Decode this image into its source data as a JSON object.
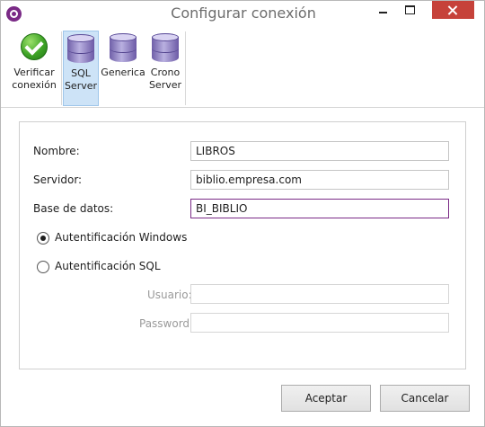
{
  "window": {
    "title": "Configurar conexión",
    "app_icon": "app-logo-icon"
  },
  "toolbar": {
    "items": [
      {
        "label": "Verificar conexión",
        "icon": "check-icon"
      },
      {
        "label": "SQL Server",
        "icon": "database-icon",
        "selected": true
      },
      {
        "label": "Generica",
        "icon": "database-icon"
      },
      {
        "label": "Crono Server",
        "icon": "database-icon"
      }
    ]
  },
  "form": {
    "nombre_label": "Nombre:",
    "nombre_value": "LIBROS",
    "servidor_label": "Servidor:",
    "servidor_value": "biblio.empresa.com",
    "base_label": "Base de datos:",
    "base_value": "BI_BIBLIO",
    "auth_windows_label": "Autentificación Windows",
    "auth_sql_label": "Autentificación SQL",
    "auth_selected": "windows",
    "usuario_label": "Usuario:",
    "usuario_value": "",
    "password_label": "Password:",
    "password_value": ""
  },
  "buttons": {
    "accept": "Aceptar",
    "cancel": "Cancelar"
  },
  "colors": {
    "accent": "#7a2a86",
    "close": "#c6423a",
    "selected": "#cde3f7"
  }
}
